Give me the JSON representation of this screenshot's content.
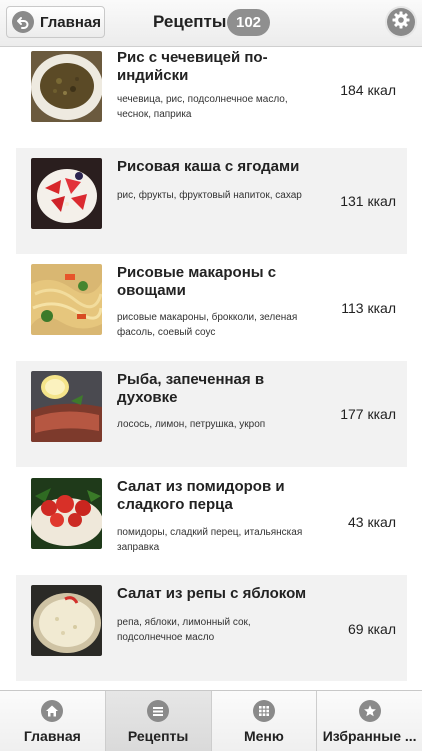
{
  "header": {
    "back_label": "Главная",
    "title": "Рецепты",
    "count": "102"
  },
  "recipes": [
    {
      "name": "Рис с чечевицей по-индийски",
      "ingredients": "чечевица, рис, подсолнечное масло, чеснок, паприка",
      "kcal": "184 ккал"
    },
    {
      "name": "Рисовая каша с ягодами",
      "ingredients": "рис, фрукты, фруктовый напиток, сахар",
      "kcal": "131 ккал"
    },
    {
      "name": "Рисовые макароны с овощами",
      "ingredients": "рисовые макароны, брокколи, зеленая фасоль, соевый соус",
      "kcal": "113 ккал"
    },
    {
      "name": "Рыба, запеченная в духовке",
      "ingredients": "лосось, лимон, петрушка, укроп",
      "kcal": "177 ккал"
    },
    {
      "name": "Салат из помидоров и сладкого перца",
      "ingredients": "помидоры, сладкий перец, итальянская заправка",
      "kcal": "43 ккал"
    },
    {
      "name": "Салат из репы с яблоком",
      "ingredients": "репа, яблоки, лимонный сок, подсолнечное масло",
      "kcal": "69 ккал"
    }
  ],
  "tabs": [
    {
      "label": "Главная",
      "icon": "home-icon"
    },
    {
      "label": "Рецепты",
      "icon": "list-icon"
    },
    {
      "label": "Меню",
      "icon": "grid-icon"
    },
    {
      "label": "Избранные ...",
      "icon": "star-icon"
    }
  ],
  "colors": {
    "row_shade": "#f2f2f2",
    "icon_gray": "#8a8a8a",
    "badge": "#8f8f8f"
  }
}
